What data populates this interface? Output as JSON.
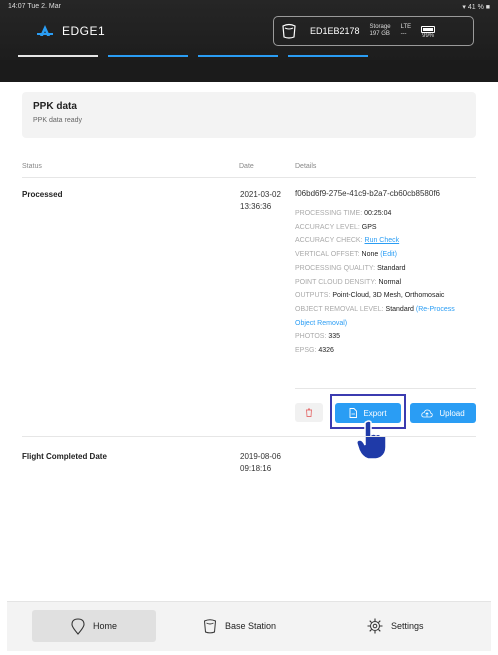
{
  "status_bar": {
    "time_date": "14:07  Tue 2. Mar",
    "battery_indicators": "▾ 41 % ■"
  },
  "header": {
    "app_name": "EDGE1",
    "device_id": "ED1EB2178",
    "storage_label": "Storage",
    "storage_value": "197 GB",
    "lte_label": "LTE",
    "lte_value": "---",
    "battery_value": "99%",
    "accent_color": "#2a9df4"
  },
  "ppk": {
    "title": "PPK data",
    "subtitle": "PPK data ready"
  },
  "table": {
    "headers": {
      "status": "Status",
      "date": "Date",
      "details": "Details"
    },
    "row1": {
      "status": "Processed",
      "date_line1": "2021-03-02",
      "date_line2": "13:36:36",
      "id": "f06bd6f9-275e-41c9-b2a7-cb60cb8580f6",
      "processing_time_k": "PROCESSING TIME:",
      "processing_time_v": "00:25:04",
      "accuracy_level_k": "ACCURACY LEVEL:",
      "accuracy_level_v": "GPS",
      "accuracy_check_k": "ACCURACY CHECK:",
      "accuracy_check_link": "Run Check",
      "vertical_offset_k": "VERTICAL OFFSET:",
      "vertical_offset_v": "None",
      "vertical_offset_link": "(Edit)",
      "processing_quality_k": "PROCESSING QUALITY:",
      "processing_quality_v": "Standard",
      "point_cloud_density_k": "POINT CLOUD DENSITY:",
      "point_cloud_density_v": "Normal",
      "outputs_k": "OUTPUTS:",
      "outputs_v": "Point-Cloud, 3D Mesh, Orthomosaic",
      "object_removal_k": "OBJECT REMOVAL LEVEL:",
      "object_removal_v": "Standard",
      "object_removal_link": "(Re-Process Object Removal)",
      "photos_k": "PHOTOS:",
      "photos_v": "335",
      "epsg_k": "EPSG:",
      "epsg_v": "4326"
    },
    "row2": {
      "status": "Flight Completed Date",
      "date_line1": "2019-08-06",
      "date_line2": "09:18:16"
    }
  },
  "actions": {
    "export_label": "Export",
    "upload_label": "Upload"
  },
  "nav": {
    "home": "Home",
    "base_station": "Base Station",
    "settings": "Settings"
  }
}
